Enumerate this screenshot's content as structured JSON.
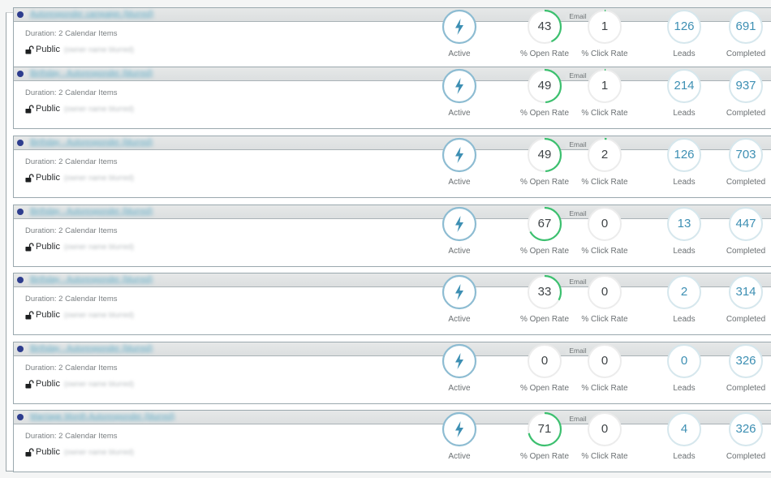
{
  "labels": {
    "email": "Email",
    "active": "Active",
    "open_rate": "% Open Rate",
    "click_rate": "% Click Rate",
    "leads": "Leads",
    "completed": "Completed"
  },
  "colors": {
    "status_dot": "#2e3d8e",
    "link": "#5aa9c4",
    "open_rate_ring": "#3cc06f",
    "active_ring": "#7fb3cc",
    "leads_ring": "#d3e6ec",
    "track": "#ececec"
  },
  "campaigns": [
    {
      "name": "Autoresponder campaign (blurred)",
      "duration": "Duration: 2 Calendar Items",
      "visibility": "Public",
      "owner": "(owner name blurred)",
      "status": "Active",
      "open_rate": 43,
      "click_rate": 1,
      "leads": 126,
      "completed": 691
    },
    {
      "name": "Birthday - Autoresponder (blurred)",
      "duration": "Duration: 2 Calendar Items",
      "visibility": "Public",
      "owner": "(owner name blurred)",
      "status": "Active",
      "open_rate": 49,
      "click_rate": 1,
      "leads": 214,
      "completed": 937
    },
    {
      "name": "Birthday - Autoresponder (blurred)",
      "duration": "Duration: 2 Calendar Items",
      "visibility": "Public",
      "owner": "(owner name blurred)",
      "status": "Active",
      "open_rate": 49,
      "click_rate": 2,
      "leads": 126,
      "completed": 703
    },
    {
      "name": "Birthday - Autoresponder (blurred)",
      "duration": "Duration: 2 Calendar Items",
      "visibility": "Public",
      "owner": "(owner name blurred)",
      "status": "Active",
      "open_rate": 67,
      "click_rate": 0,
      "leads": 13,
      "completed": 447
    },
    {
      "name": "Birthday - Autoresponder (blurred)",
      "duration": "Duration: 2 Calendar Items",
      "visibility": "Public",
      "owner": "(owner name blurred)",
      "status": "Active",
      "open_rate": 33,
      "click_rate": 0,
      "leads": 2,
      "completed": 314
    },
    {
      "name": "Birthday - Autoresponder (blurred)",
      "duration": "Duration: 2 Calendar Items",
      "visibility": "Public",
      "owner": "(owner name blurred)",
      "status": "Active",
      "open_rate": 0,
      "click_rate": 0,
      "leads": 0,
      "completed": 326
    },
    {
      "name": "Marriage Month Autoresponder (blurred)",
      "duration": "Duration: 2 Calendar Items",
      "visibility": "Public",
      "owner": "(owner name blurred)",
      "status": "Active",
      "open_rate": 71,
      "click_rate": 0,
      "leads": 4,
      "completed": 326
    }
  ]
}
